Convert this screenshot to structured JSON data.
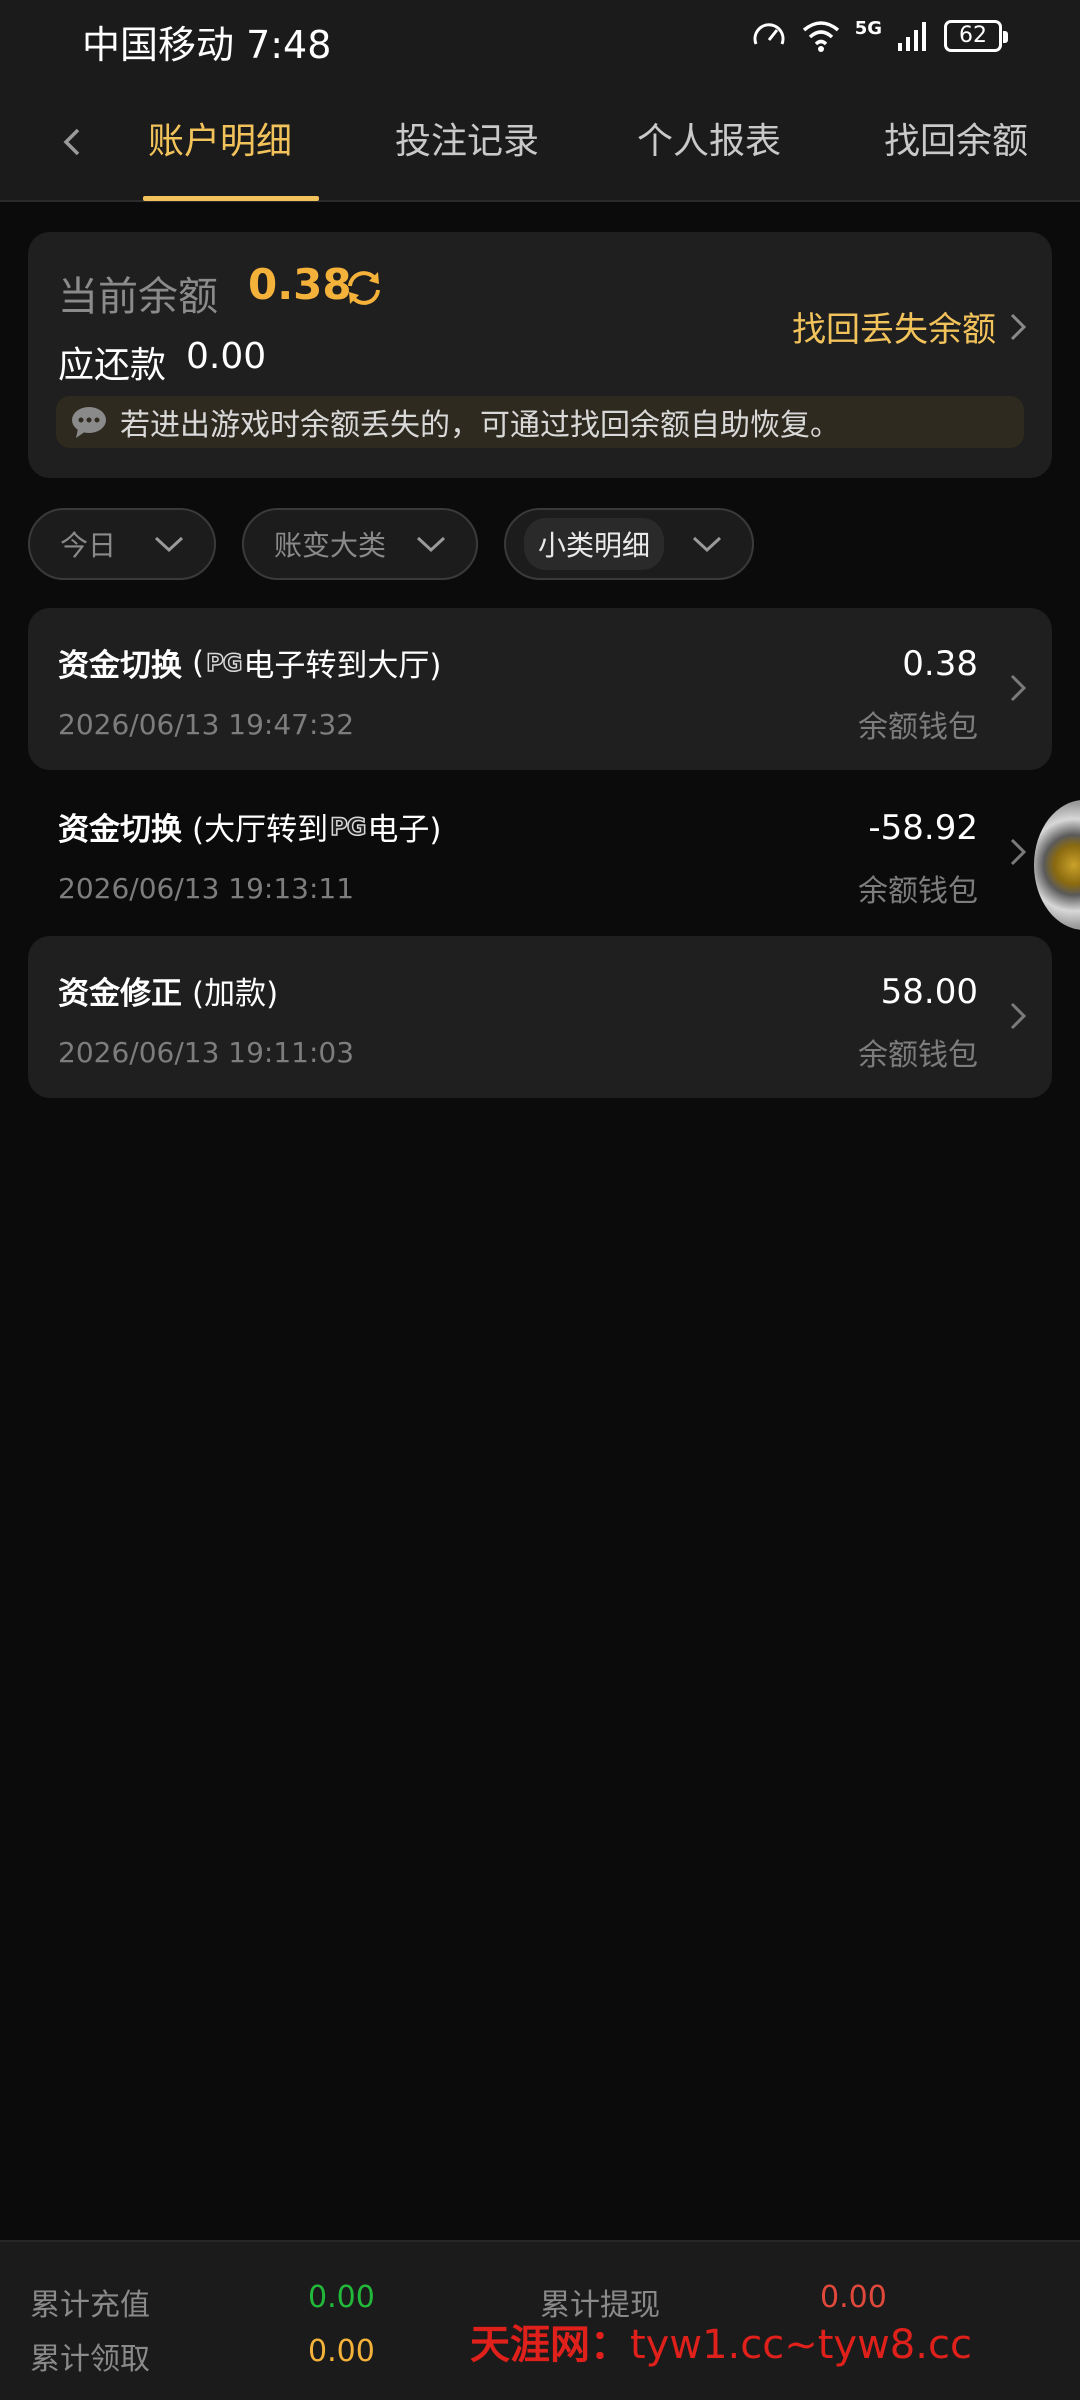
{
  "status_bar": {
    "carrier_time": "中国移动 7:48",
    "network": "5G",
    "battery": "62"
  },
  "tabs": [
    {
      "label": "账户明细",
      "active": true
    },
    {
      "label": "投注记录",
      "active": false
    },
    {
      "label": "个人报表",
      "active": false
    },
    {
      "label": "找回余额",
      "active": false
    }
  ],
  "balance": {
    "label": "当前余额",
    "value": "0.38",
    "due_label": "应还款",
    "due_value": "0.00",
    "recover_link": "找回丢失余额",
    "notice": "若进出游戏时余额丢失的，可通过找回余额自助恢复。"
  },
  "filters": [
    {
      "label": "今日"
    },
    {
      "label": "账变大类"
    },
    {
      "label": "小类明细"
    }
  ],
  "records": [
    {
      "type": "资金切换",
      "detail_pre": "(",
      "logo": "PG",
      "detail_post": "电子转到大厅)",
      "time": "2026/06/13 19:47:32",
      "amount": "0.38",
      "wallet": "余额钱包"
    },
    {
      "type": "资金切换",
      "detail_pre": "(大厅转到",
      "logo": "PG",
      "detail_post": "电子)",
      "time": "2026/06/13 19:13:11",
      "amount": "-58.92",
      "wallet": "余额钱包"
    },
    {
      "type": "资金修正",
      "detail_pre": "(加款)",
      "logo": "",
      "detail_post": "",
      "time": "2026/06/13 19:11:03",
      "amount": "58.00",
      "wallet": "余额钱包"
    }
  ],
  "summary": {
    "recharge_label": "累计充值",
    "recharge_value": "0.00",
    "withdraw_label": "累计提现",
    "withdraw_value": "0.00",
    "claim_label": "累计领取",
    "claim_value": "0.00"
  },
  "watermark": {
    "brand": "天涯网：",
    "url": "tyw1.cc~tyw8.cc"
  },
  "colors": {
    "accent": "#f2c25b",
    "balance": "#f4b23b",
    "green": "#22b83a",
    "red": "#e0483c",
    "orange": "#f4b23b"
  }
}
